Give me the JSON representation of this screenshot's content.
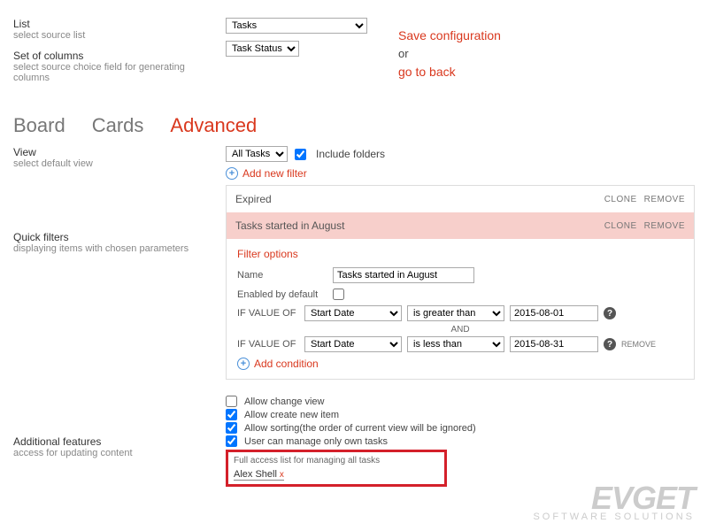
{
  "top": {
    "list_label": "List",
    "list_sub": "select source list",
    "cols_label": "Set of columns",
    "cols_sub": "select source choice field for generating columns",
    "list_value": "Tasks",
    "cols_value": "Task Status"
  },
  "actions": {
    "save": "Save configuration",
    "or": "or",
    "back": "go to back"
  },
  "tabs": {
    "board": "Board",
    "cards": "Cards",
    "advanced": "Advanced"
  },
  "view": {
    "label": "View",
    "sub": "select default view",
    "value": "All Tasks",
    "include_folders": "Include folders",
    "add_filter": "Add new filter"
  },
  "qf": {
    "label": "Quick filters",
    "sub": "displaying items with chosen parameters"
  },
  "filters": {
    "clone": "CLONE",
    "remove": "REMOVE",
    "f1_name": "Expired",
    "f2_name": "Tasks started in August"
  },
  "fo": {
    "title": "Filter options",
    "name_lbl": "Name",
    "name_val": "Tasks started in August",
    "enabled_lbl": "Enabled by default",
    "if_lbl": "IF VALUE OF",
    "field": "Start Date",
    "op1": "is greater than",
    "op2": "is less than",
    "val1": "2015-08-01",
    "val2": "2015-08-31",
    "and": "AND",
    "remove": "REMOVE",
    "add_cond": "Add condition"
  },
  "af": {
    "label": "Additional features",
    "sub": "access for updating content",
    "allow_change": "Allow change view",
    "allow_create": "Allow create new item",
    "allow_sort": "Allow sorting(the order of current view will be ignored)",
    "manage_own": "User can manage only own tasks",
    "full_access": "Full access list for managing all tasks",
    "user": "Alex Shell"
  },
  "watermark": {
    "big": "EVGET",
    "sm": "SOFTWARE SOLUTIONS"
  }
}
